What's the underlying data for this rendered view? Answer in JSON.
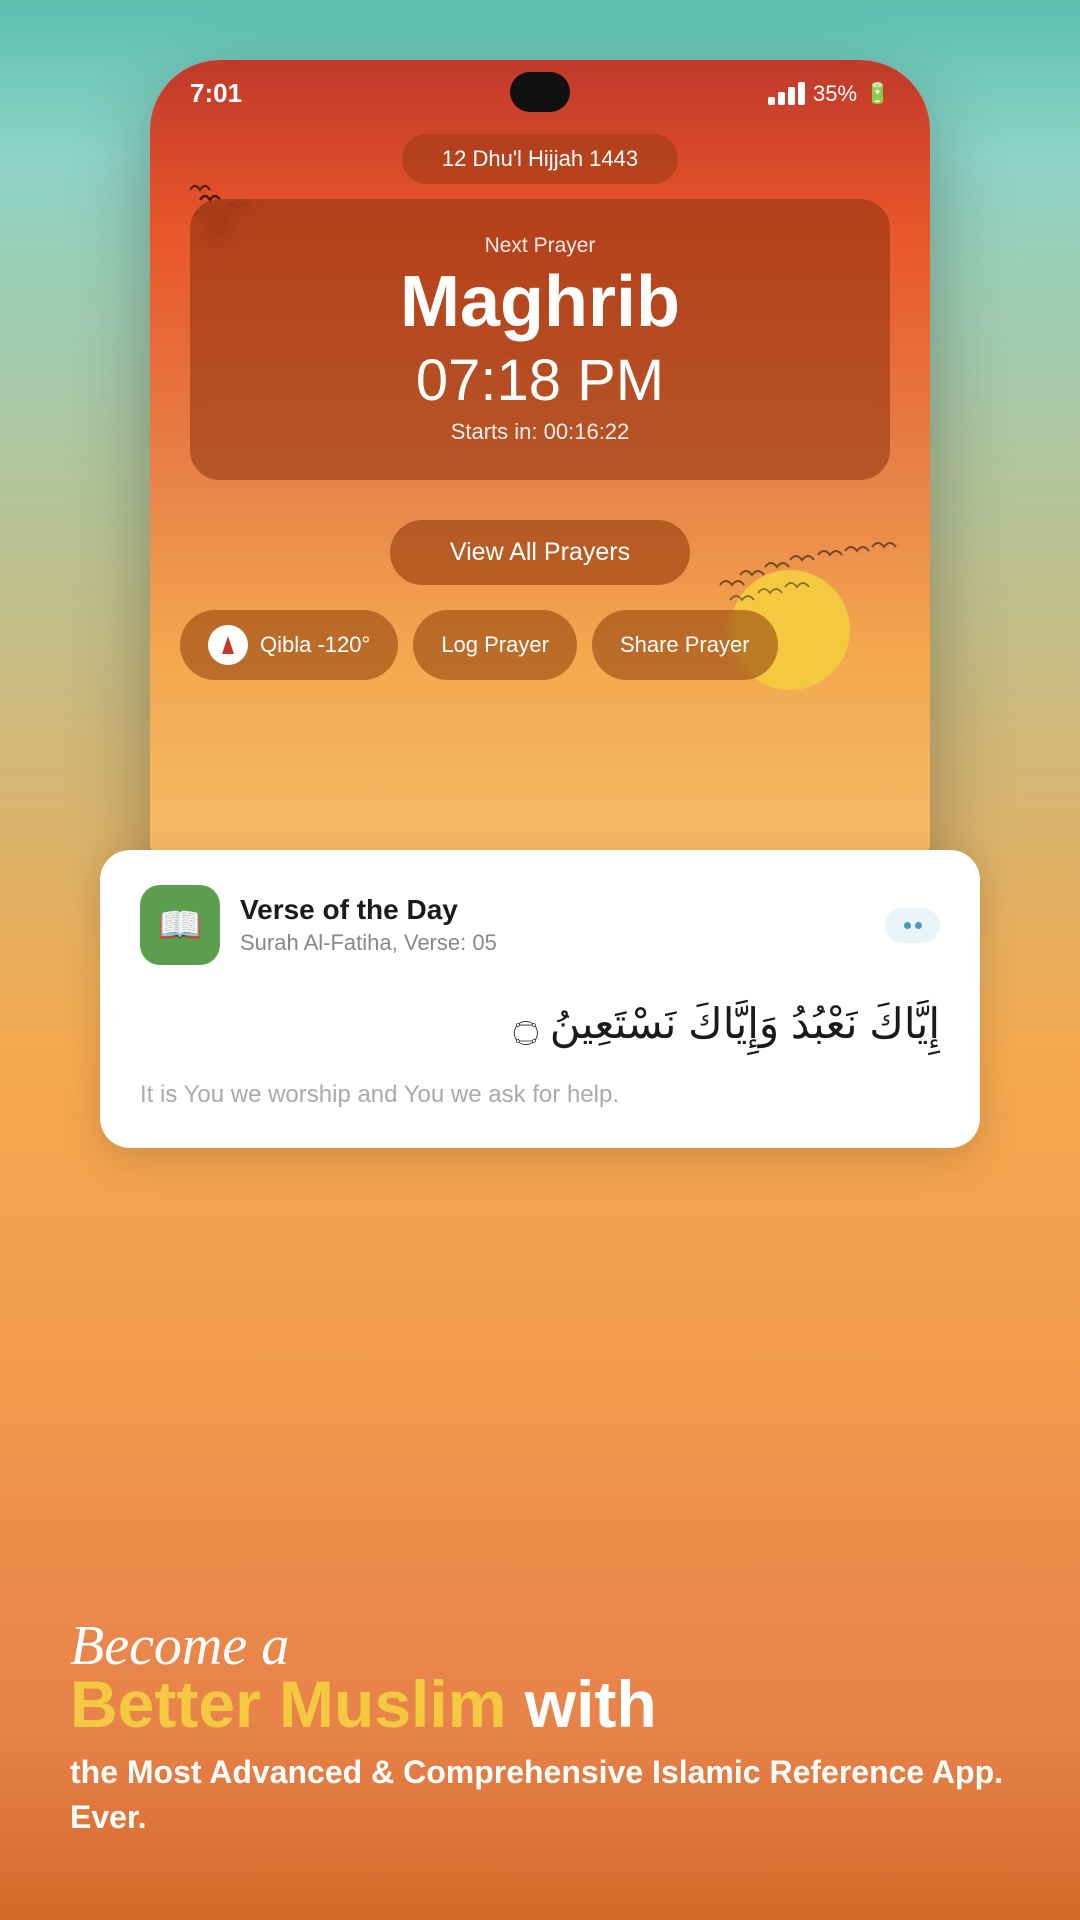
{
  "background": {
    "gradient_start": "#5bbfb0",
    "gradient_end": "#d4692a"
  },
  "status_bar": {
    "time": "7:01",
    "battery_percent": "35%",
    "signal_label": "signal"
  },
  "date_pill": {
    "text": "12 Dhu'l Hijjah 1443"
  },
  "prayer_card": {
    "next_prayer_label": "Next Prayer",
    "prayer_name": "Maghrib",
    "prayer_time": "07:18 PM",
    "starts_in_label": "Starts in:",
    "countdown": "00:16:22"
  },
  "view_all_btn": {
    "label": "View All Prayers"
  },
  "action_pills": [
    {
      "label": "Qibla -120°",
      "has_icon": true
    },
    {
      "label": "Log Prayer",
      "has_icon": false
    },
    {
      "label": "Share Prayer",
      "has_icon": false
    }
  ],
  "verse_card": {
    "title": "Verse of the Day",
    "subtitle": "Surah Al-Fatiha, Verse: 05",
    "arabic_text": "إِيَّاكَ نَعْبُدُ وَإِيَّاكَ نَسْتَعِينُ ۝",
    "translation": "It is You we worship and You we ask for help.",
    "more_btn_label": "more options"
  },
  "bottom_section": {
    "script_text": "Become a",
    "headline_part1": "Better Muslim",
    "headline_part2": " with",
    "subtitle": "the Most Advanced & Comprehensive Islamic Reference App. Ever."
  }
}
